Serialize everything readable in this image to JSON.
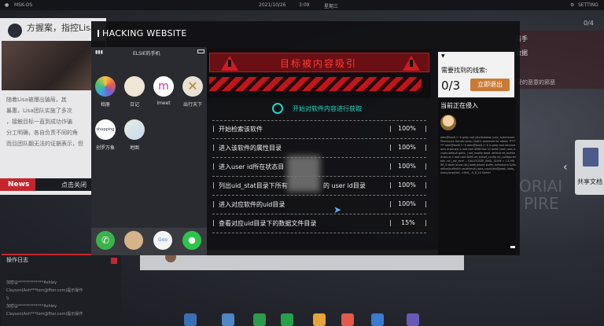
{
  "status_bar": {
    "os": "MSK-OS",
    "date": "2021/10/26",
    "time": "3:09",
    "weekday": "星期三",
    "settings": "SETTING"
  },
  "news": {
    "title": "方握案，指控Lisa",
    "body": [
      "随着Lisa被爆出骗局，其",
      "",
      "暴惠，Lisa团队实施了多次",
      "，接触目标一直到成功诈骗",
      "分工明确，各自负责不同的角",
      "而且团队翻无法的证据表示，但"
    ],
    "tag": "News",
    "close": "点击关闭"
  },
  "log": {
    "title": "操作日志",
    "lines": [
      "加密@*************Ashley",
      "Clayson(Ash***tom@flter.com)提示操作",
      "\\\\",
      "加密@*************Ashley",
      "Clayson(Ash***tom@flter.com)提示操作"
    ]
  },
  "right_panel": {
    "count": "0/4",
    "rows": [
      "前手",
      "数据"
    ],
    "line": "的爱的恶意的邪恶",
    "watermark": "ORIAI",
    "watermark2": "PIRE",
    "share": "共享文档"
  },
  "window": {
    "title": "HACKING WEBSITE",
    "phone": {
      "owner": "ELSIE的手机",
      "apps": [
        {
          "name": "相册",
          "color": "#f3f3f3"
        },
        {
          "name": "日记",
          "color": "#efe6d5"
        },
        {
          "name": "Imeet",
          "color": "#ffffff"
        },
        {
          "name": "出行天下",
          "color": "#e8e2d5"
        },
        {
          "name": "创罗万象",
          "color": "#ffffff"
        },
        {
          "name": "地图",
          "color": "#e5efe0"
        }
      ],
      "dock": [
        {
          "name": "phone-app",
          "color": "#3ab34a"
        },
        {
          "name": "contacts-app",
          "color": "#d7b38a"
        },
        {
          "name": "google-app",
          "color": "#f4f4f4"
        },
        {
          "name": "messages-app",
          "color": "#2ec34a"
        }
      ]
    },
    "alert": {
      "title": "目标被内容吸引"
    },
    "start": "开始对软件内容进行获取",
    "rows": [
      {
        "task": "开始检索该软件",
        "pct": "100%"
      },
      {
        "task": "进入该软件的属性目录",
        "pct": "100%"
      },
      {
        "task": "进入user id所在状态目",
        "pct": "100%"
      },
      {
        "task": "列出uid_stat目录下所有",
        "task2": "的 user id目录",
        "pct": "100%"
      },
      {
        "task": "进入对应软件的uid目录",
        "pct": "100%"
      },
      {
        "task": "查看对应uid目录下的数据文件目录",
        "pct": "15%"
      }
    ],
    "clue": {
      "label": "需要找到的线索:",
      "count": "0/3",
      "exit": "立即退出"
    },
    "invader": {
      "title": "当前正在侵入",
      "code": "adm@tool0.1~$ grep root /etc/shadow/ prev, subchcupin Permission Denied sudo-i Auth1 password for admin ******** adm@tool0.1~$ adm@tool0.1~$ ls grep root /etc/sudoers drwxrwxr-x root root 4096 Nov 12 dedd (root) user./scripts.default gains _root_modify dead .default ret_bufthe drwxr-xr-x root root 4096 ret_bufset_config ret_configured bits .cd /_etc_conf ... CALLOCSIZE_AVAIL_SLOW = 1 & MAXR_S dedd /show (sit) /addr/phase buffer_writestone &(Boadline)buffer/th cauth/multi_data_count(fro@grep) /data_dump/smpl/lot; ->find_ .5_0_10 Sorted"
    }
  }
}
